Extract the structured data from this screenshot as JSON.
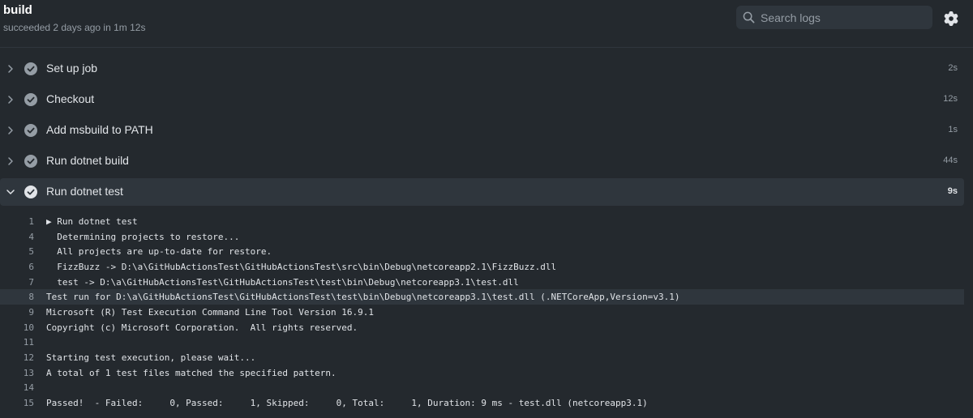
{
  "header": {
    "title": "build",
    "status": "succeeded 2 days ago in 1m 12s",
    "search_placeholder": "Search logs"
  },
  "steps": [
    {
      "label": "Set up job",
      "duration": "2s"
    },
    {
      "label": "Checkout",
      "duration": "12s"
    },
    {
      "label": "Add msbuild to PATH",
      "duration": "1s"
    },
    {
      "label": "Run dotnet build",
      "duration": "44s"
    },
    {
      "label": "Run dotnet test",
      "duration": "9s"
    }
  ],
  "log_lines": [
    {
      "num": "1",
      "text": "▶ Run dotnet test"
    },
    {
      "num": "4",
      "text": "  Determining projects to restore..."
    },
    {
      "num": "5",
      "text": "  All projects are up-to-date for restore."
    },
    {
      "num": "6",
      "text": "  FizzBuzz -> D:\\a\\GitHubActionsTest\\GitHubActionsTest\\src\\bin\\Debug\\netcoreapp2.1\\FizzBuzz.dll"
    },
    {
      "num": "7",
      "text": "  test -> D:\\a\\GitHubActionsTest\\GitHubActionsTest\\test\\bin\\Debug\\netcoreapp3.1\\test.dll"
    },
    {
      "num": "8",
      "text": "Test run for D:\\a\\GitHubActionsTest\\GitHubActionsTest\\test\\bin\\Debug\\netcoreapp3.1\\test.dll (.NETCoreApp,Version=v3.1)"
    },
    {
      "num": "9",
      "text": "Microsoft (R) Test Execution Command Line Tool Version 16.9.1"
    },
    {
      "num": "10",
      "text": "Copyright (c) Microsoft Corporation.  All rights reserved."
    },
    {
      "num": "11",
      "text": ""
    },
    {
      "num": "12",
      "text": "Starting test execution, please wait..."
    },
    {
      "num": "13",
      "text": "A total of 1 test files matched the specified pattern."
    },
    {
      "num": "14",
      "text": ""
    },
    {
      "num": "15",
      "text": "Passed!  - Failed:     0, Passed:     1, Skipped:     0, Total:     1, Duration: 9 ms - test.dll (netcoreapp3.1)"
    }
  ]
}
